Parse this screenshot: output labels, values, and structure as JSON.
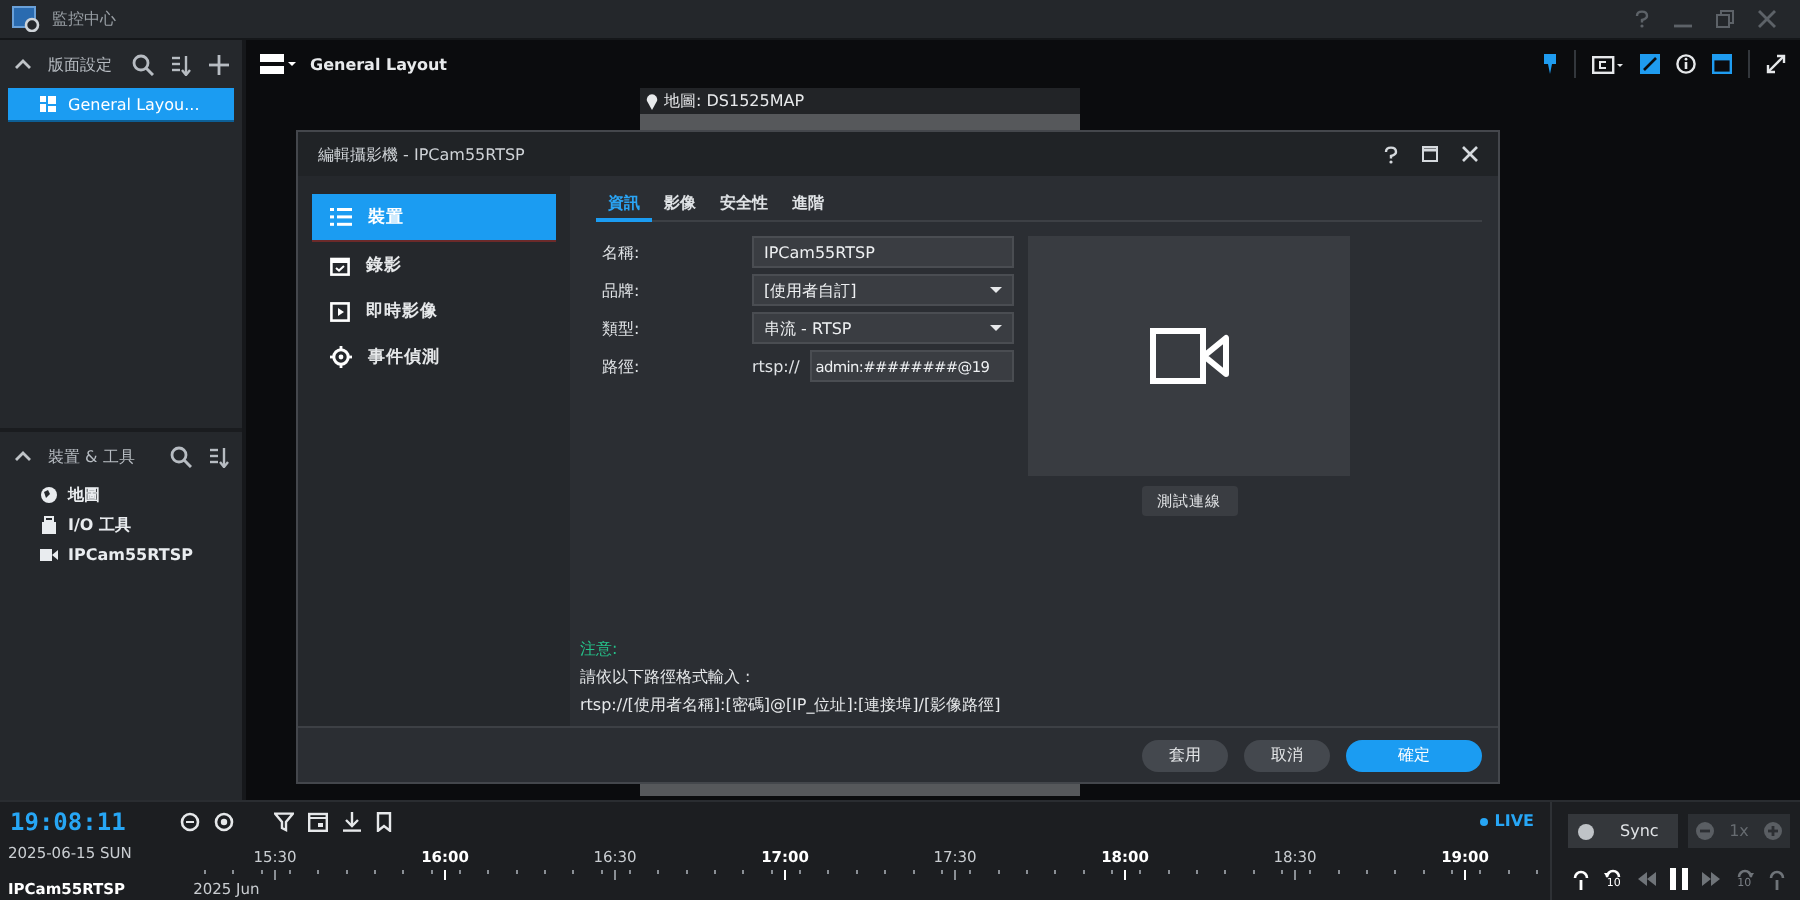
{
  "app": {
    "title": "監控中心"
  },
  "sidebar": {
    "layout_section": {
      "title": "版面設定",
      "items": [
        {
          "label": "General Layou...",
          "selected": true
        }
      ]
    },
    "device_section": {
      "title": "裝置 & 工具",
      "items": [
        {
          "label": "地圖",
          "kind": "map"
        },
        {
          "label": "I/O 工具",
          "kind": "io"
        },
        {
          "label": "IPCam55RTSP",
          "kind": "camera"
        }
      ]
    }
  },
  "layout_bar": {
    "title": "General Layout"
  },
  "map_view": {
    "label": "地圖: DS1525MAP"
  },
  "dialog": {
    "title": "編輯攝影機 - IPCam55RTSP",
    "nav": [
      {
        "label": "裝置",
        "kind": "list",
        "selected": true
      },
      {
        "label": "錄影",
        "kind": "calendar",
        "selected": false
      },
      {
        "label": "即時影像",
        "kind": "play",
        "selected": false
      },
      {
        "label": "事件偵測",
        "kind": "target",
        "selected": false
      }
    ],
    "tabs": [
      {
        "label": "資訊",
        "selected": true
      },
      {
        "label": "影像",
        "selected": false
      },
      {
        "label": "安全性",
        "selected": false
      },
      {
        "label": "進階",
        "selected": false
      }
    ],
    "fields": [
      {
        "label": "名稱:",
        "kind": "text",
        "value": "IPCam55RTSP"
      },
      {
        "label": "品牌:",
        "kind": "select",
        "value": "[使用者自訂]"
      },
      {
        "label": "類型:",
        "kind": "select",
        "value": "串流 - RTSP"
      },
      {
        "label": "路徑:",
        "kind": "prefixed",
        "prefix": "rtsp://",
        "value": "admin:########@19"
      }
    ],
    "test_button": "測試連線",
    "note": {
      "title": "注意:",
      "lines": [
        "請依以下路徑格式輸入 :",
        "rtsp://[使用者名稱]:[密碼]@[IP_位址]:[連接埠]/[影像路徑]"
      ]
    },
    "buttons": [
      {
        "label": "套用",
        "primary": false
      },
      {
        "label": "取消",
        "primary": false
      },
      {
        "label": "確定",
        "primary": true
      }
    ]
  },
  "timeline": {
    "time": "19:08:11",
    "date": "2025-06-15 SUN",
    "ticks": [
      {
        "label": "15:30",
        "major": false
      },
      {
        "label": "16:00",
        "major": true
      },
      {
        "label": "16:30",
        "major": false
      },
      {
        "label": "17:00",
        "major": true
      },
      {
        "label": "17:30",
        "major": false
      },
      {
        "label": "18:00",
        "major": true
      },
      {
        "label": "18:30",
        "major": false
      },
      {
        "label": "19:00",
        "major": true
      }
    ],
    "live": "LIVE",
    "camera": "IPCam55RTSP",
    "month": "2025 Jun",
    "sync": "Sync",
    "speed": "1x",
    "controls": [
      {
        "kind": "step-back"
      },
      {
        "kind": "skip-back",
        "label": "10"
      },
      {
        "kind": "rewind"
      },
      {
        "kind": "pause"
      },
      {
        "kind": "forward"
      },
      {
        "kind": "skip-forward",
        "label": "10"
      },
      {
        "kind": "step-forward"
      }
    ]
  }
}
